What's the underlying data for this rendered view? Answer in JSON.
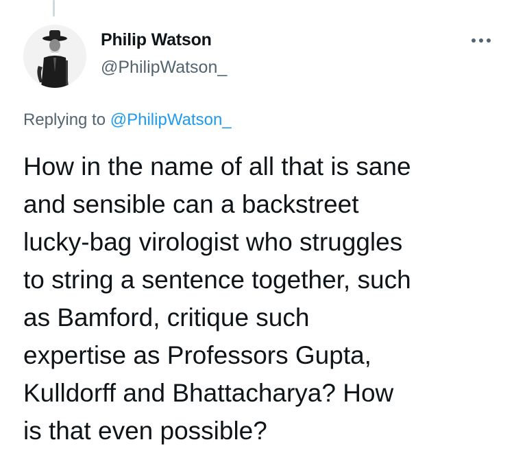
{
  "author": {
    "display_name": "Philip Watson",
    "handle": "@PhilipWatson_",
    "avatar_icon": "profile-photo"
  },
  "menu": {
    "icon": "more-horizontal-icon"
  },
  "reply": {
    "prefix": "Replying to",
    "target": "@PhilipWatson_"
  },
  "tweet": {
    "lines": [
      "How in the name of all that is sane",
      "and sensible can a backstreet",
      "lucky-bag virologist who struggles",
      "to string a sentence together, such",
      "as Bamford, critique such",
      "expertise as Professors Gupta,",
      "Kulldorff and Bhattacharya? How",
      "is that even possible?"
    ]
  },
  "colors": {
    "text": "#0f1419",
    "secondary": "#536471",
    "link": "#1d9bf0",
    "thread_line": "#cfd9de"
  }
}
